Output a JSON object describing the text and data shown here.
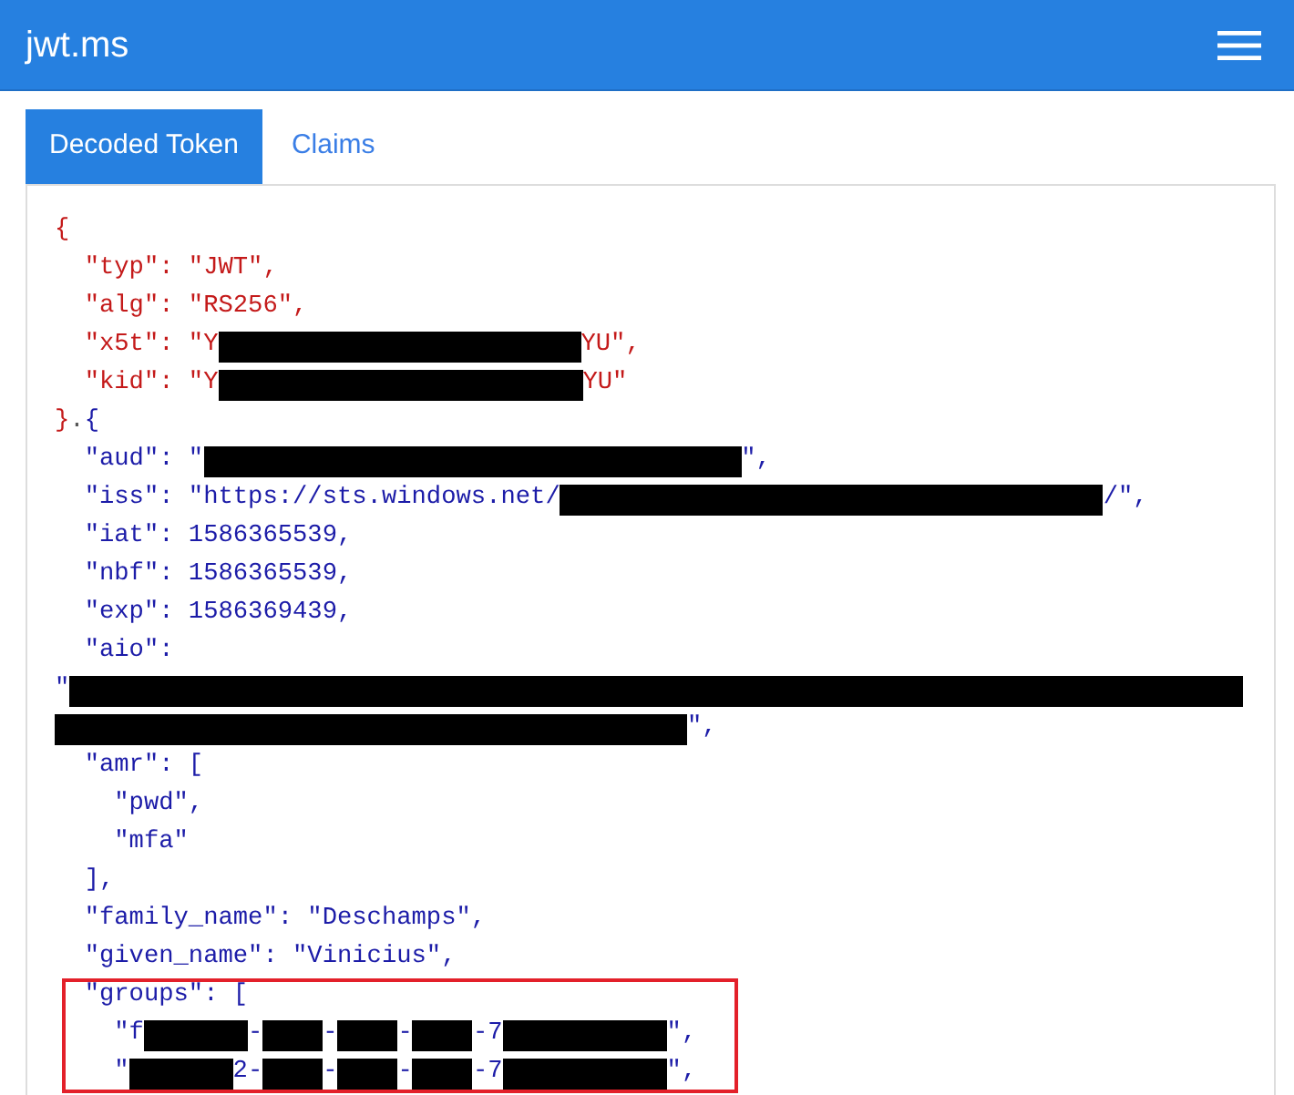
{
  "navbar": {
    "brand": "jwt.ms"
  },
  "tabs": [
    {
      "label": "Decoded Token",
      "selected": true
    },
    {
      "label": "Claims",
      "selected": false
    }
  ],
  "token": {
    "lines": [
      {
        "segments": [
          {
            "kind": "header",
            "text": "{"
          }
        ],
        "highlighted": false,
        "children": [
          {
            "segments": [
              {
                "kind": "header",
                "text": "\"typ\": \"JWT\","
              }
            ],
            "highlighted": false
          },
          {
            "segments": [
              {
                "kind": "header",
                "text": "\"alg\": \"RS256\","
              }
            ],
            "highlighted": false
          },
          {
            "segments": [
              {
                "kind": "header",
                "text": "\"x5t\": \"Y"
              },
              {
                "kind": "redacted"
              },
              {
                "kind": "header",
                "text": "YU\","
              }
            ],
            "highlighted": false
          },
          {
            "segments": [
              {
                "kind": "header",
                "text": "\"kid\": \"Y"
              },
              {
                "kind": "redacted"
              },
              {
                "kind": "header",
                "text": "YU\""
              }
            ],
            "highlighted": false
          }
        ]
      },
      {
        "segments": [
          {
            "kind": "header",
            "text": "}"
          },
          {
            "kind": "separator",
            "text": "."
          },
          {
            "kind": "payload",
            "text": "{"
          }
        ],
        "highlighted": false,
        "children": [
          {
            "segments": [
              {
                "kind": "payload",
                "text": "\"aud\": \""
              },
              {
                "kind": "redacted"
              },
              {
                "kind": "payload",
                "text": "\","
              }
            ],
            "highlighted": false
          },
          {
            "segments": [
              {
                "kind": "payload",
                "text": "\"iss\": \"https://sts.windows.net/"
              },
              {
                "kind": "redacted"
              },
              {
                "kind": "payload",
                "text": "/\","
              }
            ],
            "highlighted": false
          },
          {
            "segments": [
              {
                "kind": "payload",
                "text": "\"iat\": 1586365539,"
              }
            ],
            "highlighted": false
          },
          {
            "segments": [
              {
                "kind": "payload",
                "text": "\"nbf\": 1586365539,"
              }
            ],
            "highlighted": false
          },
          {
            "segments": [
              {
                "kind": "payload",
                "text": "\"exp\": 1586369439,"
              }
            ],
            "highlighted": false
          },
          {
            "segments": [
              {
                "kind": "payload",
                "text": "\"aio\":"
              }
            ],
            "highlighted": false,
            "wrapped": [
              [
                {
                  "kind": "payload",
                  "text": "\""
                },
                {
                  "kind": "redacted"
                }
              ],
              [
                {
                  "kind": "redacted"
                },
                {
                  "kind": "payload",
                  "text": "\","
                }
              ]
            ]
          },
          {
            "segments": [
              {
                "kind": "payload",
                "text": "\"amr\": ["
              }
            ],
            "highlighted": false,
            "children": [
              {
                "segments": [
                  {
                    "kind": "payload",
                    "text": "\"pwd\","
                  }
                ],
                "highlighted": false
              },
              {
                "segments": [
                  {
                    "kind": "payload",
                    "text": "\"mfa\""
                  }
                ],
                "highlighted": false
              }
            ]
          },
          {
            "segments": [
              {
                "kind": "payload",
                "text": "],"
              }
            ],
            "highlighted": false
          },
          {
            "segments": [
              {
                "kind": "payload",
                "text": "\"family_name\": \"Deschamps\","
              }
            ],
            "highlighted": false
          },
          {
            "segments": [
              {
                "kind": "payload",
                "text": "\"given_name\": \"Vinicius\","
              }
            ],
            "highlighted": false
          },
          {
            "segments": [
              {
                "kind": "payload",
                "text": "\"groups\": ["
              }
            ],
            "highlighted": true,
            "children": [
              {
                "segments": [
                  {
                    "kind": "payload",
                    "text": "\"f"
                  },
                  {
                    "kind": "redacted"
                  },
                  {
                    "kind": "payload",
                    "text": "-"
                  },
                  {
                    "kind": "redacted"
                  },
                  {
                    "kind": "payload",
                    "text": "-"
                  },
                  {
                    "kind": "redacted"
                  },
                  {
                    "kind": "payload",
                    "text": "-"
                  },
                  {
                    "kind": "redacted"
                  },
                  {
                    "kind": "payload",
                    "text": "-7"
                  },
                  {
                    "kind": "redacted"
                  },
                  {
                    "kind": "payload",
                    "text": "\","
                  }
                ],
                "highlighted": false
              },
              {
                "segments": [
                  {
                    "kind": "payload",
                    "text": "\""
                  },
                  {
                    "kind": "redacted"
                  },
                  {
                    "kind": "payload",
                    "text": "2-"
                  },
                  {
                    "kind": "redacted"
                  },
                  {
                    "kind": "payload",
                    "text": "-"
                  },
                  {
                    "kind": "redacted"
                  },
                  {
                    "kind": "payload",
                    "text": "-"
                  },
                  {
                    "kind": "redacted"
                  },
                  {
                    "kind": "payload",
                    "text": "-7"
                  },
                  {
                    "kind": "redacted"
                  },
                  {
                    "kind": "payload",
                    "text": "\","
                  }
                ],
                "highlighted": false
              }
            ]
          }
        ]
      }
    ]
  }
}
